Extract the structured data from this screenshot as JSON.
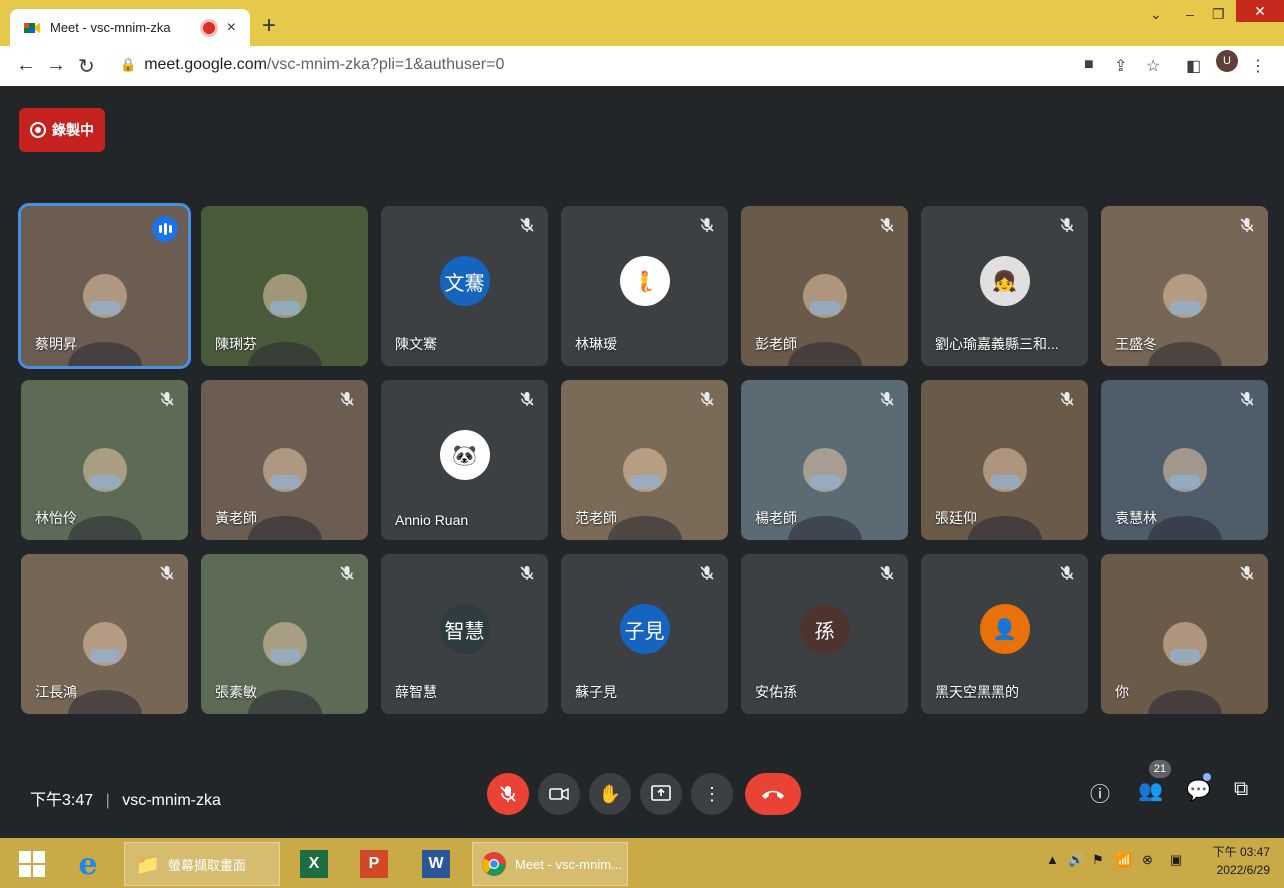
{
  "browser": {
    "tab_title": "Meet - vsc-mnim-zka",
    "tab_close": "×",
    "new_tab": "+",
    "url_host": "meet.google.com",
    "url_path": "/vsc-mnim-zka?pli=1&authuser=0",
    "profile_initial": "U"
  },
  "recording": {
    "label": "錄製中"
  },
  "participants": [
    {
      "name": "蔡明昇",
      "type": "video",
      "speaking": true,
      "muted": false
    },
    {
      "name": "陳琍芬",
      "type": "video",
      "muted": false
    },
    {
      "name": "陳文騫",
      "type": "avatar",
      "initials": "文騫",
      "color": "#1565c0",
      "muted": true
    },
    {
      "name": "林琳瑷",
      "type": "avatar",
      "initials": "🧜",
      "color": "#ffffff",
      "muted": true
    },
    {
      "name": "彭老師",
      "type": "video",
      "muted": true
    },
    {
      "name": "劉心瑜嘉義縣三和...",
      "type": "avatar",
      "initials": "👧",
      "color": "#e0e0e0",
      "muted": true
    },
    {
      "name": "王盛冬",
      "type": "video",
      "muted": true
    },
    {
      "name": "林怡伶",
      "type": "video",
      "muted": true
    },
    {
      "name": "黃老師",
      "type": "video",
      "muted": true
    },
    {
      "name": "Annio Ruan",
      "type": "avatar",
      "initials": "🐼",
      "color": "#ffffff",
      "muted": true
    },
    {
      "name": "范老師",
      "type": "video",
      "muted": true
    },
    {
      "name": "楊老師",
      "type": "video",
      "muted": true
    },
    {
      "name": "張廷仰",
      "type": "video",
      "muted": true
    },
    {
      "name": "袁慧林",
      "type": "video",
      "muted": true
    },
    {
      "name": "江長鴻",
      "type": "video",
      "muted": true
    },
    {
      "name": "張素敏",
      "type": "video",
      "muted": true
    },
    {
      "name": "薛智慧",
      "type": "avatar",
      "initials": "智慧",
      "color": "#2e3b3f",
      "muted": true
    },
    {
      "name": "蘇子見",
      "type": "avatar",
      "initials": "子見",
      "color": "#1565c0",
      "muted": true
    },
    {
      "name": "安佑孫",
      "type": "avatar",
      "initials": "孫",
      "color": "#4e342e",
      "muted": true
    },
    {
      "name": "黑天空黑黑的",
      "type": "avatar",
      "initials": "👤",
      "color": "#e8710a",
      "muted": true
    },
    {
      "name": "你",
      "type": "video",
      "muted": true
    }
  ],
  "bottom_bar": {
    "time": "下午3:47",
    "separator": "|",
    "meeting_code": "vsc-mnim-zka",
    "people_count": "21"
  },
  "taskbar": {
    "folder_label": "螢幕擷取畫面",
    "chrome_label": "Meet - vsc-mnim...",
    "clock_time": "下午 03:47",
    "clock_date": "2022/6/29"
  }
}
